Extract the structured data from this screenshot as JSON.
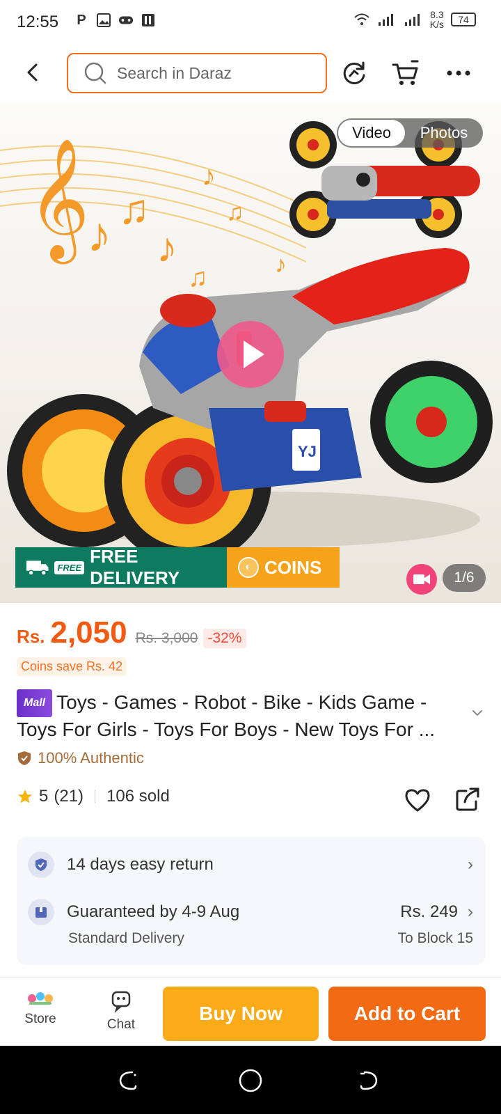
{
  "status_bar": {
    "time": "12:55",
    "left_icons": [
      "p-icon",
      "image-icon",
      "gamepad-icon",
      "pdf-icon"
    ],
    "net_speed_value": "8.3",
    "net_speed_unit": "K/s",
    "battery": "74"
  },
  "header": {
    "search_placeholder": "Search in Daraz",
    "icons": [
      "back-icon",
      "search-icon",
      "refresh-icon",
      "cart-icon",
      "more-icon"
    ]
  },
  "media": {
    "toggle_video": "Video",
    "toggle_photos": "Photos",
    "promo_free_tag": "FREE",
    "promo_free_delivery": "FREE DELIVERY",
    "promo_coins": "COINS",
    "counter": "1/6"
  },
  "product": {
    "currency": "Rs.",
    "price": "2,050",
    "original_price": "Rs. 3,000",
    "discount": "-32%",
    "coins_save": "Coins save Rs. 42",
    "mall_badge": "Mall",
    "title": "Toys - Games - Robot - Bike - Kids Game - Toys For Girls - Toys For Boys - New Toys For ...",
    "authentic": "100% Authentic",
    "rating": "5",
    "rating_count": "(21)",
    "sold": "106 sold"
  },
  "services": {
    "return_label": "14 days easy return",
    "delivery_label": "Guaranteed by 4-9 Aug",
    "delivery_type": "Standard Delivery",
    "delivery_price": "Rs. 249",
    "delivery_location": "To Block 15"
  },
  "bottom_bar": {
    "store_label": "Store",
    "chat_label": "Chat",
    "buy_now": "Buy Now",
    "add_to_cart": "Add to Cart"
  },
  "colors": {
    "brand_orange": "#f36a14",
    "buy_now_yellow": "#fbaa18",
    "promo_green": "#0e7a5f"
  }
}
